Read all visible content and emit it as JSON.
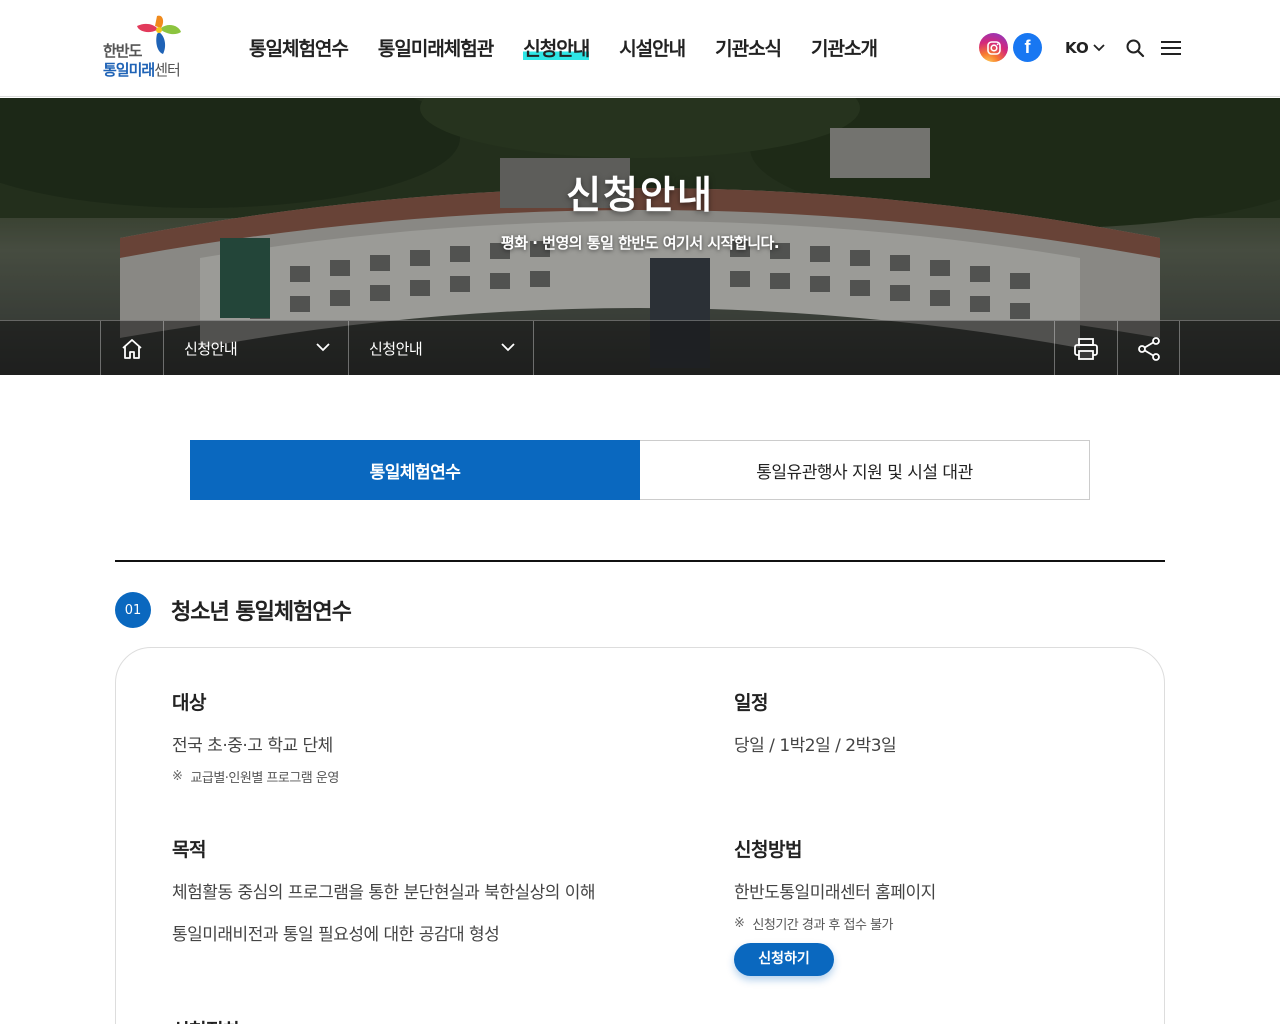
{
  "logo": {
    "line1": "한반도",
    "line2_strong": "통일미래",
    "line2_rest": "센터"
  },
  "gnb": [
    "통일체험연수",
    "통일미래체험관",
    "신청안내",
    "시설안내",
    "기관소식",
    "기관소개"
  ],
  "util": {
    "lang": "KO",
    "fb_letter": "f"
  },
  "visual": {
    "title": "신청안내",
    "subtitle": "평화 · 번영의 통일 한반도 여기서 시작합니다."
  },
  "location": {
    "depth1": "신청안내",
    "depth2": "신청안내"
  },
  "tabs": [
    "통일체험연수",
    "통일유관행사 지원 및 시설 대관"
  ],
  "section": {
    "number": "01",
    "title": "청소년 통일체험연수",
    "target": {
      "heading": "대상",
      "desc": "전국 초·중·고 학교 단체",
      "note_mark": "※",
      "note": "교급별·인원별 프로그램 운영"
    },
    "schedule": {
      "heading": "일정",
      "desc": "당일 / 1박2일 / 2박3일"
    },
    "purpose": {
      "heading": "목적",
      "lines": [
        "체험활동 중심의 프로그램을 통한 분단현실과 북한실상의 이해",
        "통일미래비전과 통일 필요성에 대한 공감대 형성"
      ]
    },
    "method": {
      "heading": "신청방법",
      "desc": "한반도통일미래센터 홈페이지",
      "note_mark": "※",
      "note": "신청기간 경과 후 접수 불가",
      "button": "신청하기"
    },
    "next_heading": "신청절차"
  },
  "colors": {
    "primary": "#0a68bf",
    "highlight": "#2ee6e6"
  }
}
